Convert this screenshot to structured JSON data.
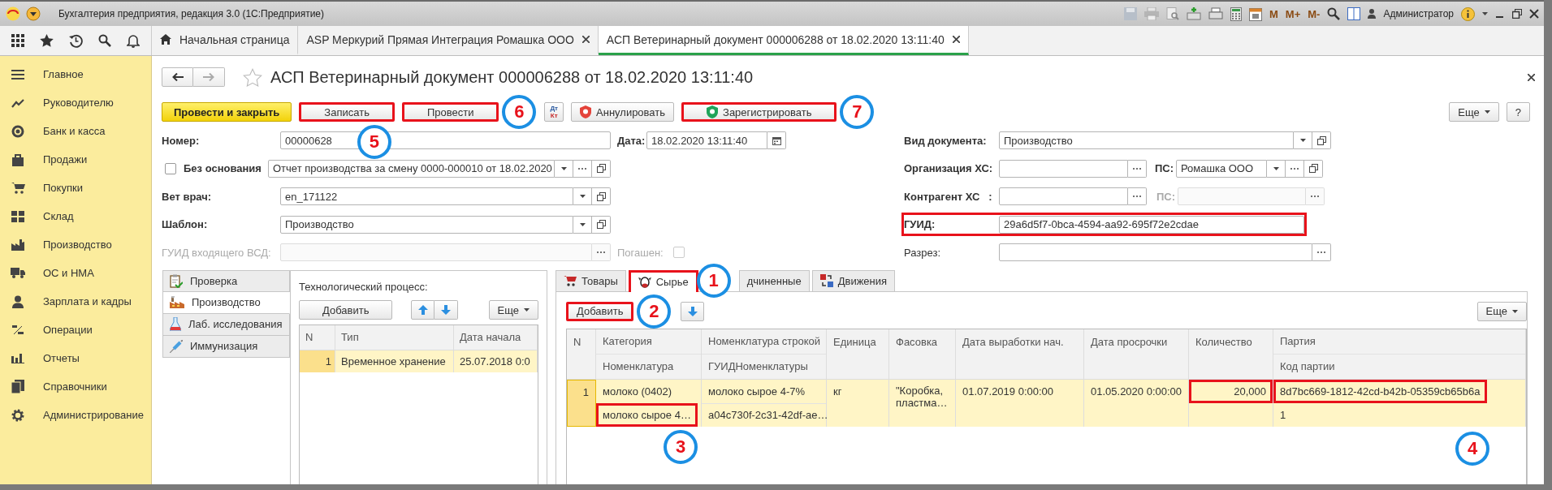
{
  "window": {
    "title": "Бухгалтерия предприятия, редакция 3.0  (1С:Предприятие)",
    "memory_buttons": [
      "M",
      "M+",
      "M-"
    ],
    "user": "Администратор"
  },
  "open_tabs": [
    {
      "label": "Начальная страница",
      "selected": false,
      "closable": false
    },
    {
      "label": "ASP Меркурий Прямая Интеграция Ромашка ООО",
      "selected": false,
      "closable": true
    },
    {
      "label": "АСП Ветеринарный документ 000006288 от 18.02.2020 13:11:40",
      "selected": true,
      "closable": true
    }
  ],
  "sidebar": {
    "items": [
      {
        "label": "Главное"
      },
      {
        "label": "Руководителю"
      },
      {
        "label": "Банк и касса"
      },
      {
        "label": "Продажи"
      },
      {
        "label": "Покупки"
      },
      {
        "label": "Склад"
      },
      {
        "label": "Производство"
      },
      {
        "label": "ОС и НМА"
      },
      {
        "label": "Зарплата и кадры"
      },
      {
        "label": "Операции"
      },
      {
        "label": "Отчеты"
      },
      {
        "label": "Справочники"
      },
      {
        "label": "Администрирование"
      }
    ]
  },
  "form": {
    "title": "АСП Ветеринарный документ 000006288 от 18.02.2020 13:11:40",
    "toolbar": [
      {
        "kind": "primary",
        "label": "Провести и закрыть",
        "highlighted": false
      },
      {
        "kind": "button",
        "label": "Записать",
        "highlighted": true,
        "callout": "5"
      },
      {
        "kind": "button",
        "label": "Провести",
        "highlighted": true,
        "callout": "6"
      },
      {
        "kind": "dtkt",
        "top": "Дт",
        "bottom": "Кт",
        "highlighted": false
      },
      {
        "kind": "cancel",
        "label": "Аннулировать",
        "highlighted": false
      },
      {
        "kind": "register",
        "label": "Зарегистрировать",
        "highlighted": true,
        "callout": "7"
      }
    ],
    "more_button": "Еще",
    "help_button": "?",
    "fields": {
      "number": {
        "label": "Номер:",
        "value": "00000628",
        "bold": true
      },
      "date": {
        "label": "Дата:",
        "value": "18.02.2020 13:11:40",
        "bold": true
      },
      "basis": {
        "label": "Без основания",
        "checked": false,
        "bold": true,
        "value": "Отчет производства за смену 0000-000010 от 18.02.2020"
      },
      "vet": {
        "label": "Вет врач:",
        "value": "en_171122",
        "bold": true
      },
      "template": {
        "label": "Шаблон:",
        "value": "Производство",
        "bold": true
      },
      "incoming_guid": {
        "label": "ГУИД входящего ВСД:",
        "bold": false,
        "disabled": true
      },
      "redeemed": {
        "label": "Погашен:",
        "bold": false,
        "checked": false,
        "disabled": true
      },
      "doc_type": {
        "label": "Вид документа:",
        "value": "Производство",
        "bold": true
      },
      "org": {
        "label": "Организация ХС:",
        "bold": true
      },
      "org_ps": {
        "label": "ПС:",
        "value": "Ромашка ООО",
        "bold": true
      },
      "contractor": {
        "label": "Контрагент ХС   :",
        "bold": true
      },
      "contractor_ps": {
        "label": "ПС:",
        "bold": true,
        "disabled": true
      },
      "guid": {
        "label": "ГУИД:",
        "value": "29a6d5f7-0bca-4594-aa92-695f72e2cdae",
        "bold": true,
        "highlighted": true
      },
      "section": {
        "label": "Разрез:",
        "bold": false
      }
    },
    "side_tabs": [
      {
        "label": "Проверка",
        "selected": false
      },
      {
        "label": "Производство",
        "selected": true
      },
      {
        "label": "Лаб. исследования",
        "selected": false
      },
      {
        "label": "Иммунизация",
        "selected": false
      }
    ],
    "process": {
      "title": "Технологический процесс:",
      "add_button": "Добавить",
      "more_button": "Еще",
      "columns": [
        "N",
        "Тип",
        "Дата начала"
      ],
      "rows": [
        {
          "selected": true,
          "cells": [
            "1",
            "Временное хранение",
            "25.07.2018 0:0"
          ]
        }
      ]
    },
    "detail_tabs": [
      {
        "label": "Товары",
        "selected": false,
        "highlighted": false
      },
      {
        "label": "Сырье",
        "selected": true,
        "highlighted": true,
        "callout": "1"
      },
      {
        "label": "дчиненные",
        "selected": false,
        "highlighted": false
      },
      {
        "label": "Движения",
        "selected": false,
        "highlighted": false
      }
    ],
    "materials": {
      "add_button": {
        "label": "Добавить",
        "highlighted": true,
        "callout": "2"
      },
      "more_button": "Еще",
      "columns": [
        {
          "lines": [
            "N"
          ]
        },
        {
          "lines": [
            "Категория",
            "Номенклатура"
          ]
        },
        {
          "lines": [
            "Номенклатура строкой",
            "ГУИДНоменклатуры"
          ]
        },
        {
          "lines": [
            "Единица"
          ]
        },
        {
          "lines": [
            "Фасовка"
          ]
        },
        {
          "lines": [
            "Дата выработки нач."
          ]
        },
        {
          "lines": [
            "Дата просрочки"
          ]
        },
        {
          "lines": [
            "Количество"
          ]
        },
        {
          "lines": [
            "Партия",
            "Код партии"
          ]
        }
      ],
      "rows": [
        {
          "selected": true,
          "cells": [
            {
              "lines": [
                {
                  "text": "1",
                  "highlighted": false
                }
              ]
            },
            {
              "lines": [
                {
                  "text": "молоко (0402)",
                  "highlighted": false
                },
                {
                  "text": "молоко сырое 4…",
                  "highlighted": true,
                  "callout": "3"
                }
              ]
            },
            {
              "lines": [
                {
                  "text": "молоко сырое 4-7%",
                  "highlighted": false
                },
                {
                  "text": "a04c730f-2c31-42df-ae…",
                  "highlighted": false
                }
              ]
            },
            {
              "lines": [
                {
                  "text": "кг",
                  "highlighted": false
                }
              ]
            },
            {
              "lines": [
                {
                  "text": "\"Коробка, пластма…",
                  "highlighted": false
                }
              ]
            },
            {
              "lines": [
                {
                  "text": "01.07.2019 0:00:00",
                  "highlighted": false
                }
              ]
            },
            {
              "lines": [
                {
                  "text": "01.05.2020 0:00:00",
                  "highlighted": false
                }
              ]
            },
            {
              "lines": [
                {
                  "text": "20,000",
                  "highlighted": true
                }
              ]
            },
            {
              "lines": [
                {
                  "text": "8d7bc669-1812-42cd-b42b-05359cb65b6a",
                  "highlighted": true,
                  "callout": "4"
                },
                {
                  "text": "1",
                  "highlighted": false
                }
              ]
            }
          ]
        }
      ]
    }
  }
}
